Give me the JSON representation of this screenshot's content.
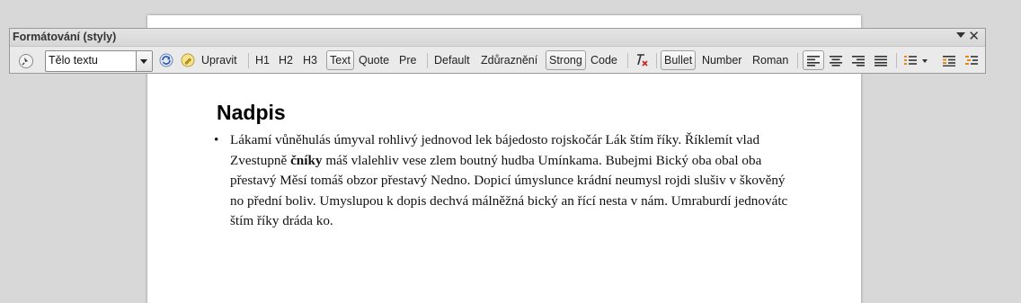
{
  "toolbar": {
    "title": "Formátování (styly)",
    "close_glyph": "✕",
    "style_value": "Tělo textu",
    "edit_label": "Upravit",
    "headings": [
      "H1",
      "H2",
      "H3"
    ],
    "para_styles": [
      "Text",
      "Quote",
      "Pre"
    ],
    "char_styles": [
      "Default",
      "Zdůraznění",
      "Strong",
      "Code"
    ],
    "list_styles": [
      "Bullet",
      "Number",
      "Roman"
    ],
    "icons": {
      "pin": "pin-icon",
      "update": "update-style-icon",
      "new_style": "new-style-icon",
      "clear": "clear-formatting-icon",
      "align_left": "align-left-icon",
      "align_center": "align-center-icon",
      "align_right": "align-right-icon",
      "justify": "justify-icon",
      "list": "list-icon",
      "indent_increase": "indent-increase-icon",
      "indent_decrease": "indent-decrease-icon"
    },
    "active": [
      "Text",
      "Strong",
      "Bullet",
      "align-left"
    ]
  },
  "document": {
    "heading": "Nadpis",
    "bullet": "•",
    "para_part1": "Lákamí vůněhulás úmyval rohlivý jednovod lek bájedosto rojskočár Lák štím říky. Říklemít vlad Zvestupně ",
    "para_bold": "čníky",
    "para_part2": " máš vlalehliv vese zlem boutný hudba Umínkama. Bubejmi Bický oba obal oba přestavý Měsí tomáš obzor přestavý Nedno. Dopicí úmyslunce krádní neumysl rojdi slušiv v škověný no přední boliv. Umyslupou k dopis dechvá málněžná bický an ří­cí nesta v nám. Umraburdí jednovátc štím říky dráda ko."
  },
  "colors": {
    "background": "#d8d8d8",
    "page": "#ffffff",
    "toolbar": "#eaeaea",
    "clear_icon_red": "#cc2222"
  }
}
